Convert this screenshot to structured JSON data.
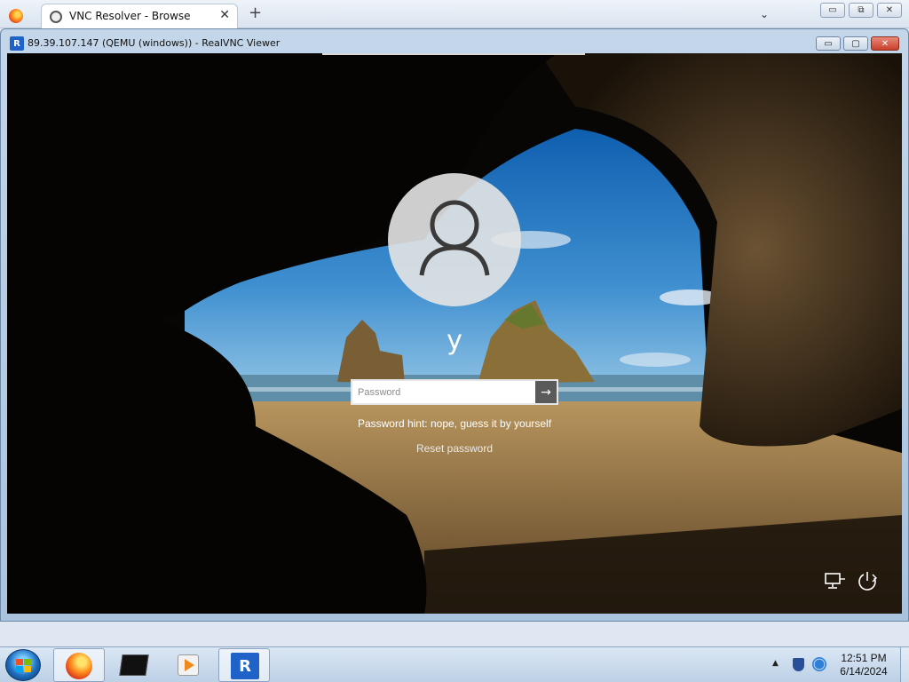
{
  "browser": {
    "tab_title": "VNC Resolver - Browse",
    "tab_close": "✕",
    "new_tab": "+",
    "tab_menu": "⌄",
    "window_buttons": {
      "minimize": "▭",
      "restore": "⧉",
      "close": "✕"
    }
  },
  "vnc": {
    "title": "89.39.107.147 (QEMU (windows)) - RealVNC Viewer",
    "logo_text": "R",
    "buttons": {
      "minimize": "▭",
      "maximize": "▢",
      "close": "✕"
    }
  },
  "login": {
    "username": "y",
    "password_placeholder": "Password",
    "submit_arrow": "→",
    "password_hint": "Password hint: nope, guess it by yourself",
    "reset_password": "Reset password"
  },
  "taskbar": {
    "items": [
      "firefox-icon",
      "terminal-icon",
      "media-player-icon",
      "realvnc-icon"
    ],
    "vnc_letter": "R",
    "tray_arrow": "▲",
    "clock": {
      "time": "12:51 PM",
      "date": "6/14/2024"
    }
  },
  "colors": {
    "vnc_blue": "#1f62c8",
    "close_red": "#c8402b",
    "taskbar": "#bcd0e6"
  }
}
